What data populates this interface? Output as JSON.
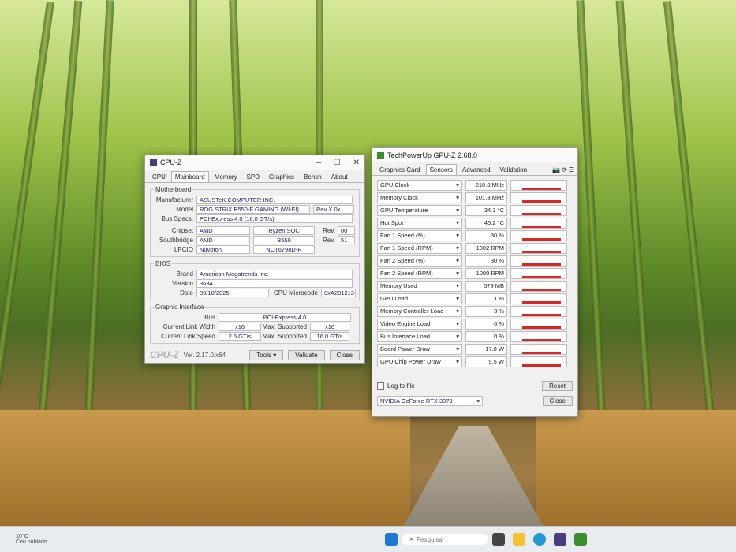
{
  "cpuz": {
    "title": "CPU-Z",
    "tabs": [
      "CPU",
      "Mainboard",
      "Memory",
      "SPD",
      "Graphics",
      "Bench",
      "About"
    ],
    "active_tab": "Mainboard",
    "motherboard": {
      "legend": "Motherboard",
      "manufacturer_label": "Manufacturer",
      "manufacturer": "ASUSTeK COMPUTER INC.",
      "model_label": "Model",
      "model": "ROG STRIX B550-F GAMING (WI-FI)",
      "model_rev": "Rev X.0x",
      "busspecs_label": "Bus Specs.",
      "busspecs": "PCI-Express 4.0 (16.0 GT/s)",
      "chipset_label": "Chipset",
      "chipset_vendor": "AMD",
      "chipset_name": "Ryzen SOC",
      "chipset_rev_label": "Rev.",
      "chipset_rev": "00",
      "southbridge_label": "Southbridge",
      "southbridge_vendor": "AMD",
      "southbridge_name": "B550",
      "southbridge_rev_label": "Rev.",
      "southbridge_rev": "51",
      "lpcio_label": "LPCIO",
      "lpcio_vendor": "Nuvoton",
      "lpcio_name": "NCT6798D-R"
    },
    "bios": {
      "legend": "BIOS",
      "brand_label": "Brand",
      "brand": "American Megatrends Inc.",
      "version_label": "Version",
      "version": "3634",
      "date_label": "Date",
      "date": "09/10/2025",
      "microcode_label": "CPU Microcode",
      "microcode": "0xA201213"
    },
    "graphic_interface": {
      "legend": "Graphic Interface",
      "bus_label": "Bus",
      "bus": "PCI-Express 4.0",
      "link_width_label": "Current Link Width",
      "link_width": "x16",
      "max_width_label": "Max. Supported",
      "max_width": "x16",
      "link_speed_label": "Current Link Speed",
      "link_speed": "2.5 GT/s",
      "max_speed_label": "Max. Supported",
      "max_speed": "16.0 GT/s"
    },
    "footer": {
      "brand": "CPU-Z",
      "version": "Ver. 2.17.0.x64",
      "tools": "Tools",
      "validate": "Validate",
      "close": "Close"
    }
  },
  "gpuz": {
    "title": "TechPowerUp GPU-Z 2.68.0",
    "tabs": [
      "Graphics Card",
      "Sensors",
      "Advanced",
      "Validation"
    ],
    "active_tab": "Sensors",
    "sensors": [
      {
        "name": "GPU Clock",
        "value": "210.0 MHz"
      },
      {
        "name": "Memory Clock",
        "value": "101.3 MHz"
      },
      {
        "name": "GPU Temperature",
        "value": "34.3 °C"
      },
      {
        "name": "Hot Spot",
        "value": "45.2 °C"
      },
      {
        "name": "Fan 1 Speed (%)",
        "value": "30 %"
      },
      {
        "name": "Fan 1 Speed (RPM)",
        "value": "1002 RPM"
      },
      {
        "name": "Fan 2 Speed (%)",
        "value": "30 %"
      },
      {
        "name": "Fan 2 Speed (RPM)",
        "value": "1000 RPM"
      },
      {
        "name": "Memory Used",
        "value": "579 MB"
      },
      {
        "name": "GPU Load",
        "value": "1 %"
      },
      {
        "name": "Memory Controller Load",
        "value": "3 %"
      },
      {
        "name": "Video Engine Load",
        "value": "0 %"
      },
      {
        "name": "Bus Interface Load",
        "value": "0 %"
      },
      {
        "name": "Board Power Draw",
        "value": "17.0 W"
      },
      {
        "name": "GPU Chip Power Draw",
        "value": "9.5 W"
      }
    ],
    "log_label": "Log to file",
    "reset": "Reset",
    "device": "NVIDIA GeForce RTX 3070",
    "close": "Close"
  },
  "taskbar": {
    "temp": "10°C",
    "weather": "Céu nublado",
    "search_placeholder": "Pesquisar"
  },
  "colors": {
    "graph_red": "#d62828",
    "window_bg": "#f0f0f0"
  }
}
